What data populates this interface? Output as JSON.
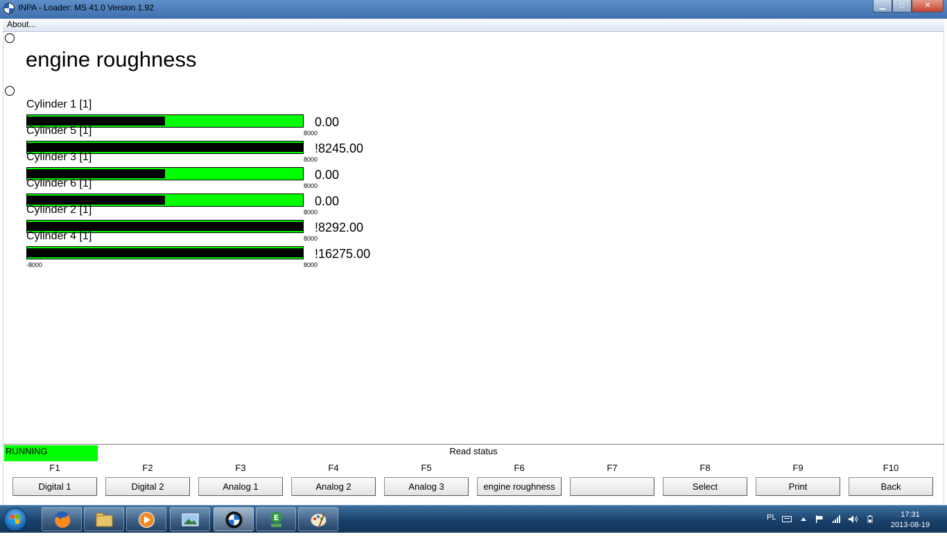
{
  "window": {
    "title": "INPA - Loader:  MS 41.0 Version 1.92",
    "controls": {
      "minimize": "▁",
      "maximize": "□",
      "close": "✕"
    }
  },
  "menu": {
    "about": "About..."
  },
  "page": {
    "title": "engine roughness"
  },
  "gauges": [
    {
      "label": "Cylinder 1 [1]",
      "value": "0.00",
      "fill": 0.5,
      "max_label": "8000"
    },
    {
      "label": "Cylinder 5 [1]",
      "value": "!8245.00",
      "fill": 1.0,
      "max_label": "8000"
    },
    {
      "label": "Cylinder 3 [1]",
      "value": "0.00",
      "fill": 0.5,
      "max_label": "8000"
    },
    {
      "label": "Cylinder 6 [1]",
      "value": "0.00",
      "fill": 0.5,
      "max_label": "8000"
    },
    {
      "label": "Cylinder 2 [1]",
      "value": "!8292.00",
      "fill": 1.0,
      "max_label": "8000"
    },
    {
      "label": "Cylinder 4 [1]",
      "value": "!16275.00",
      "fill": 1.0,
      "max_label": "8000",
      "min_label": "-8000"
    }
  ],
  "status": {
    "running": "RUNNING",
    "read_status": "Read status",
    "running_color": "#00ff00"
  },
  "function_keys": [
    {
      "key": "F1",
      "label": "Digital 1"
    },
    {
      "key": "F2",
      "label": "Digital 2"
    },
    {
      "key": "F3",
      "label": "Analog 1"
    },
    {
      "key": "F4",
      "label": "Analog 2"
    },
    {
      "key": "F5",
      "label": "Analog 3"
    },
    {
      "key": "F6",
      "label": "engine roughness"
    },
    {
      "key": "F7",
      "label": ""
    },
    {
      "key": "F8",
      "label": "Select"
    },
    {
      "key": "F9",
      "label": "Print"
    },
    {
      "key": "F10",
      "label": "Back"
    }
  ],
  "taskbar": {
    "apps": [
      "firefox-icon",
      "file-explorer-icon",
      "media-player-icon",
      "image-viewer-icon",
      "bmw-inpa-icon",
      "ediabas-icon",
      "paint-icon"
    ],
    "language": "PL",
    "time": "17:31",
    "date": "2013-08-19"
  }
}
